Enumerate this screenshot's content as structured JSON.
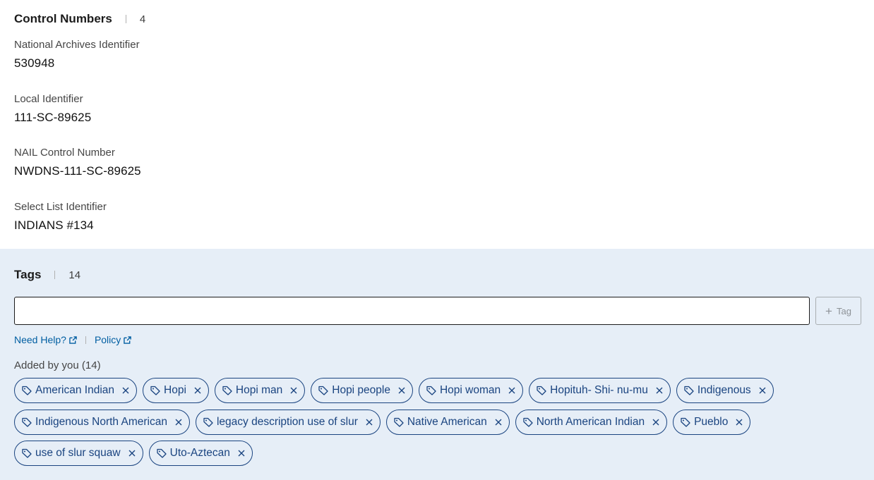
{
  "control": {
    "title": "Control Numbers",
    "count": "4",
    "fields": [
      {
        "label": "National Archives Identifier",
        "value": "530948"
      },
      {
        "label": "Local Identifier",
        "value": "111-SC-89625"
      },
      {
        "label": "NAIL Control Number",
        "value": "NWDNS-111-SC-89625"
      },
      {
        "label": "Select List Identifier",
        "value": "INDIANS #134"
      }
    ]
  },
  "tags": {
    "title": "Tags",
    "count": "14",
    "input": {
      "value": "",
      "placeholder": ""
    },
    "add_button_label": "Tag",
    "help_link": "Need Help?",
    "policy_link": "Policy",
    "added_by": "Added by you (14)",
    "items": [
      "American Indian",
      "Hopi",
      "Hopi man",
      "Hopi people",
      "Hopi woman",
      "Hopituh- Shi- nu-mu",
      "Indigenous",
      "Indigenous North American",
      "legacy description use of slur",
      "Native American",
      "North American Indian",
      "Pueblo",
      "use of slur squaw",
      "Uto-Aztecan"
    ]
  },
  "colors": {
    "accent": "#1a4480",
    "link": "#005ea2",
    "tags_background": "#e6eef7"
  }
}
